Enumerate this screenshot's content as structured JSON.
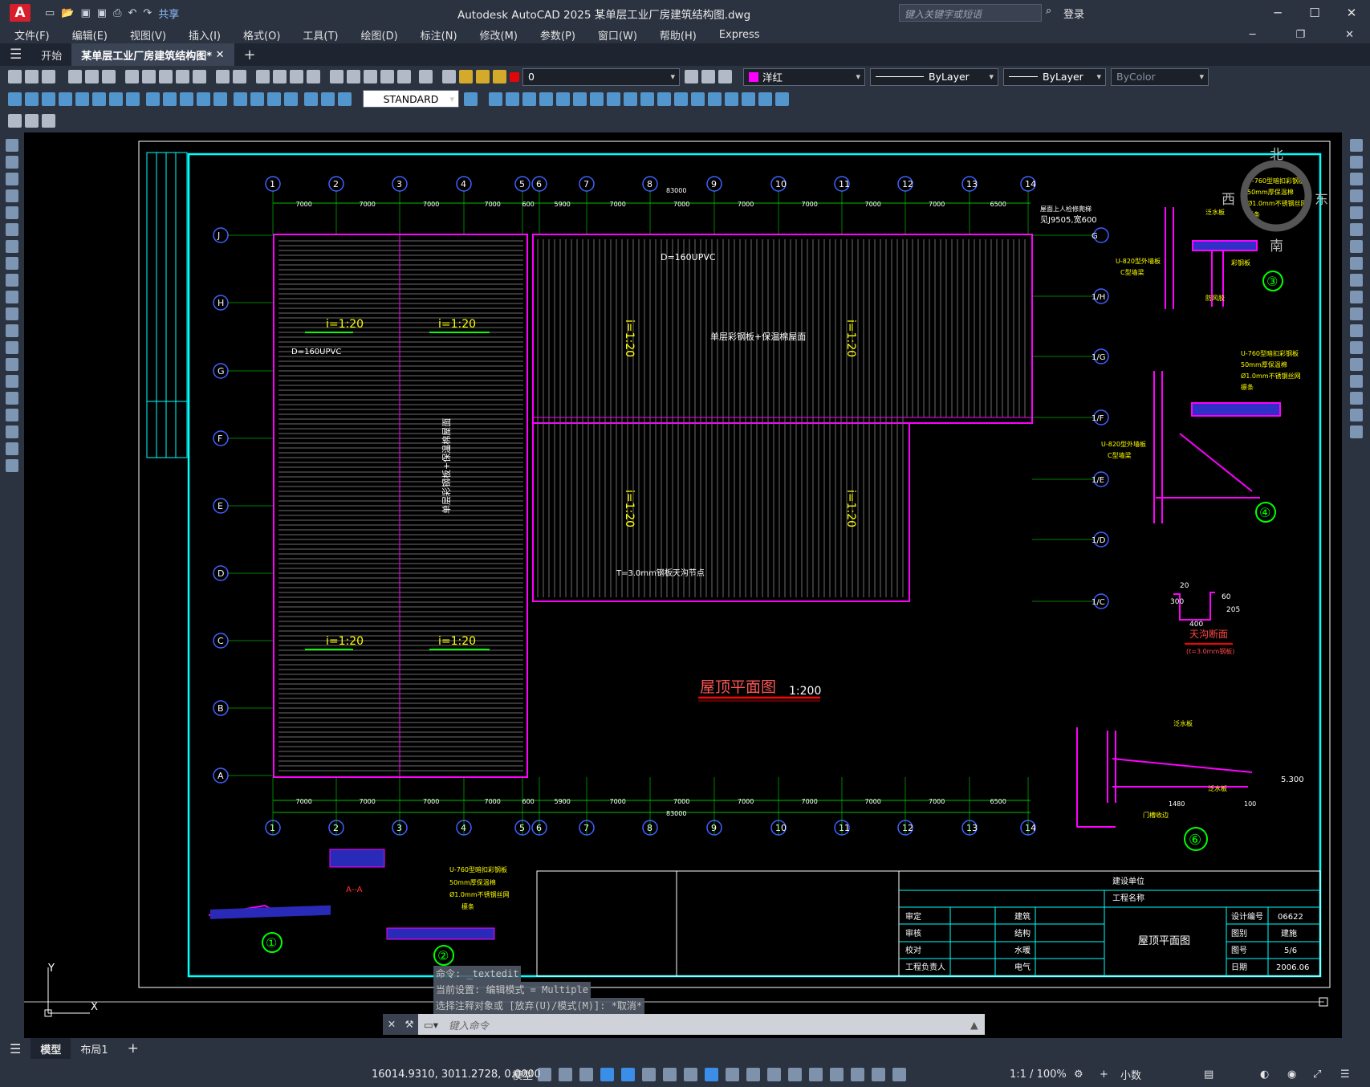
{
  "app": {
    "title": "Autodesk AutoCAD 2025    某单层工业厂房建筑结构图.dwg",
    "share": "共享",
    "search_placeholder": "键入关键字或短语",
    "login": "登录"
  },
  "menu": [
    "文件(F)",
    "编辑(E)",
    "视图(V)",
    "插入(I)",
    "格式(O)",
    "工具(T)",
    "绘图(D)",
    "标注(N)",
    "修改(M)",
    "参数(P)",
    "窗口(W)",
    "帮助(H)",
    "Express"
  ],
  "tabs": {
    "start": "开始",
    "drawing": "某单层工业厂房建筑结构图*"
  },
  "props": {
    "layer": "0",
    "color": "洋红",
    "linetype": "ByLayer",
    "lineweight": "ByLayer",
    "plotstyle": "ByColor",
    "textstyle": "STANDARD"
  },
  "drawing": {
    "grid_top": [
      "1",
      "2",
      "3",
      "4",
      "5",
      "6",
      "7",
      "8",
      "9",
      "10",
      "11",
      "12",
      "13",
      "14"
    ],
    "grid_left": [
      "J",
      "H",
      "G",
      "F",
      "E",
      "D",
      "C",
      "B",
      "A"
    ],
    "grid_right": [
      "G",
      "1/H",
      "1/G",
      "1/F",
      "1/E",
      "1/D",
      "1/C"
    ],
    "dims_top": [
      "7000",
      "7000",
      "7000",
      "7000",
      "600",
      "5900",
      "7000",
      "7000",
      "7000",
      "7000",
      "7000",
      "7000",
      "6500"
    ],
    "total": "83000",
    "slope": "i=1:20",
    "pipe": "D=160UPVC",
    "roof_label": "单层彩钢板+保温棉屋面",
    "plan_title": "屋顶平面图",
    "plan_scale": "1:200",
    "gutter_title": "天沟断面",
    "gutter_note": "(t=3.0mm钢板)",
    "gutter_dims": [
      "20",
      "300",
      "60",
      "205",
      "400"
    ],
    "gutter_plate": "T=3.0mm钢板天沟节点",
    "section_aa": "A--A",
    "detail_nums": [
      "①",
      "②",
      "③",
      "④",
      "⑥"
    ],
    "elevation": "5.300",
    "notes": [
      "U-760型暗扣彩钢板",
      "50mm厚保温棉",
      "Ø1.0mm不锈钢丝网",
      "檩条",
      "U-820型外墙板",
      "C型墙梁",
      "彩钢板",
      "防风胶",
      "泛水板",
      "门槽收边",
      "1480",
      "100",
      "屋面上人检修爬梯",
      "见J9505,宽600"
    ],
    "titleblock": {
      "unit": "建设单位",
      "project": "工程名称",
      "rows": [
        [
          "审定",
          "建筑"
        ],
        [
          "审核",
          "结构"
        ],
        [
          "校对",
          "水暖"
        ],
        [
          "工程负责人",
          "电气"
        ]
      ],
      "drawing_name": "屋顶平面图",
      "design_no_label": "设计编号",
      "design_no": "06622",
      "cat_label": "图别",
      "cat": "建施",
      "no_label": "图号",
      "no": "5/6",
      "date_label": "日期",
      "date": "2006.06"
    },
    "compass": {
      "n": "北",
      "s": "南",
      "e": "东",
      "w": "西"
    }
  },
  "command": {
    "history": [
      "命令: _textedit",
      "当前设置: 编辑模式 = Multiple",
      "选择注释对象或 [放弃(U)/模式(M)]: *取消*"
    ],
    "placeholder": "键入命令"
  },
  "layout_tabs": [
    "模型",
    "布局1"
  ],
  "status": {
    "coords": "16014.9310, 3011.2728, 0.0000",
    "space": "模型",
    "scale": "1:1 / 100%",
    "units": "小数"
  }
}
